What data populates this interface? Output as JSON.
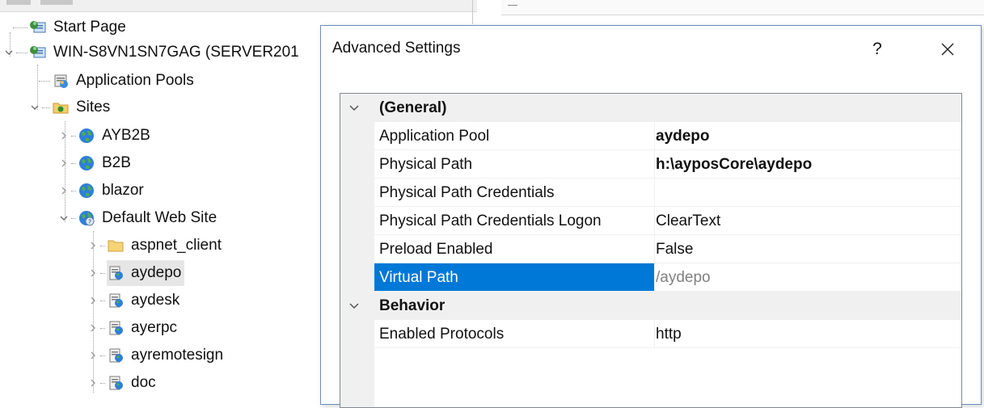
{
  "tree": {
    "items": [
      {
        "label": "Start Page",
        "icon": "start-page-icon"
      },
      {
        "label": "WIN-S8VN1SN7GAG (SERVER201",
        "icon": "server-icon"
      },
      {
        "label": "Application Pools",
        "icon": "application-pools-icon"
      },
      {
        "label": "Sites",
        "icon": "sites-folder-icon"
      },
      {
        "label": "AYB2B",
        "icon": "globe-icon"
      },
      {
        "label": "B2B",
        "icon": "globe-icon"
      },
      {
        "label": "blazor",
        "icon": "globe-icon"
      },
      {
        "label": "Default Web Site",
        "icon": "default-site-icon"
      },
      {
        "label": "aspnet_client",
        "icon": "folder-icon"
      },
      {
        "label": "aydepo",
        "icon": "application-icon"
      },
      {
        "label": "aydesk",
        "icon": "application-icon"
      },
      {
        "label": "ayerpc",
        "icon": "application-icon"
      },
      {
        "label": "ayremotesign",
        "icon": "application-icon"
      },
      {
        "label": "doc",
        "icon": "application-icon"
      }
    ]
  },
  "dialog": {
    "title": "Advanced Settings",
    "help_label": "?",
    "close_icon": "close-icon",
    "categories": [
      {
        "name": "(General)",
        "rows": [
          {
            "name": "Application Pool",
            "value": "aydepo",
            "bold": true
          },
          {
            "name": "Physical Path",
            "value": "h:\\ayposCore\\aydepo",
            "bold": true
          },
          {
            "name": "Physical Path Credentials",
            "value": ""
          },
          {
            "name": "Physical Path Credentials Logon",
            "value": "ClearText"
          },
          {
            "name": "Preload Enabled",
            "value": "False"
          },
          {
            "name": "Virtual Path",
            "value": "/aydepo",
            "selected": true
          }
        ]
      },
      {
        "name": "Behavior",
        "rows": [
          {
            "name": "Enabled Protocols",
            "value": "http"
          }
        ]
      }
    ]
  },
  "colors": {
    "selection": "#0078d7",
    "grid_gutter": "#f0f0f0",
    "dialog_border": "#6b8fbf"
  }
}
